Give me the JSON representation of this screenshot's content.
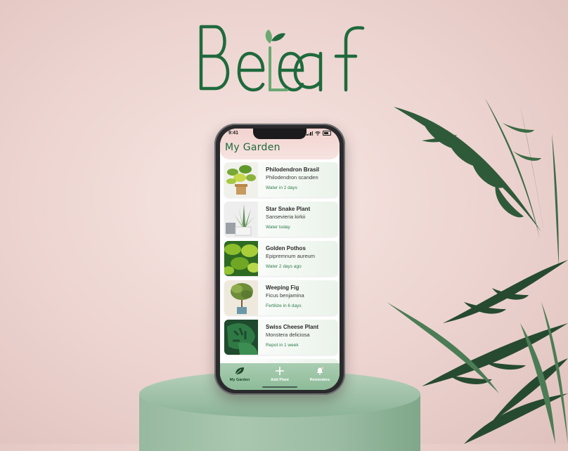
{
  "brand": {
    "name": "BeLeaf",
    "color": "#1f6a3c"
  },
  "status_bar": {
    "time": "9:41"
  },
  "screen": {
    "title": "My Garden"
  },
  "plants": [
    {
      "name": "Philodendron Brasil",
      "scientific": "Philodendron scanden",
      "task": "Water in 2 days"
    },
    {
      "name": "Star Snake Plant",
      "scientific": "Sansevieria kirkii",
      "task": "Water today"
    },
    {
      "name": "Golden Pothos",
      "scientific": "Epipremnum aureum",
      "task": "Water 2 days ago"
    },
    {
      "name": "Weeping Fig",
      "scientific": "Ficus benjamina",
      "task": "Fertilize in 6 days"
    },
    {
      "name": "Swiss Cheese Plant",
      "scientific": "Monstera deliciosa",
      "task": "Repot in 1 week"
    }
  ],
  "tabs": [
    {
      "label": "My Garden",
      "icon": "leaf-icon"
    },
    {
      "label": "Add Plant",
      "icon": "plus-icon"
    },
    {
      "label": "Reminders",
      "icon": "bell-icon"
    }
  ]
}
